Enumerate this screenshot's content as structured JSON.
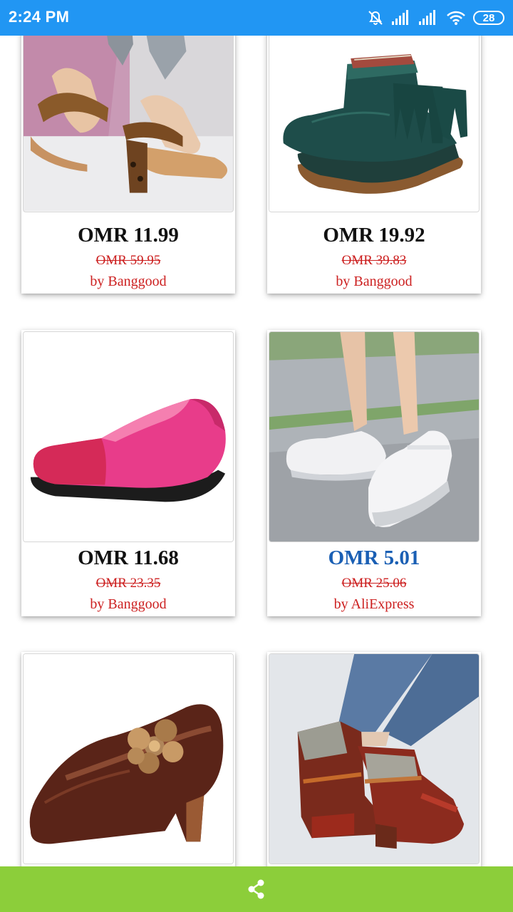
{
  "status_bar": {
    "time": "2:24 PM",
    "battery": "28",
    "icons": [
      "alarm-off-icon",
      "signal-icon",
      "signal-icon",
      "wifi-icon",
      "battery-icon"
    ]
  },
  "products": [
    {
      "price": "OMR 11.99",
      "old_price": "OMR 59.95",
      "seller": "by Banggood",
      "image": "leopard-sandal"
    },
    {
      "price": "OMR 19.92",
      "old_price": "OMR 39.83",
      "seller": "by Banggood",
      "image": "green-fringe-boot"
    },
    {
      "price": "OMR 11.68",
      "old_price": "OMR 23.35",
      "seller": "by Banggood",
      "image": "pink-loafer"
    },
    {
      "price": "OMR 5.01",
      "old_price": "OMR 25.06",
      "seller": "by AliExpress",
      "image": "white-sneaker"
    },
    {
      "price": "",
      "old_price": "",
      "seller": "",
      "image": "brown-flower-heel"
    },
    {
      "price": "",
      "old_price": "",
      "seller": "",
      "image": "patterned-ankle-boot"
    }
  ],
  "bottom_bar": {
    "icon": "share-icon",
    "color": "#8CCE3A"
  },
  "colors": {
    "status_bar": "#2196F3",
    "price_highlight": "#1a5fb4",
    "old_price": "#cc1f1f"
  }
}
